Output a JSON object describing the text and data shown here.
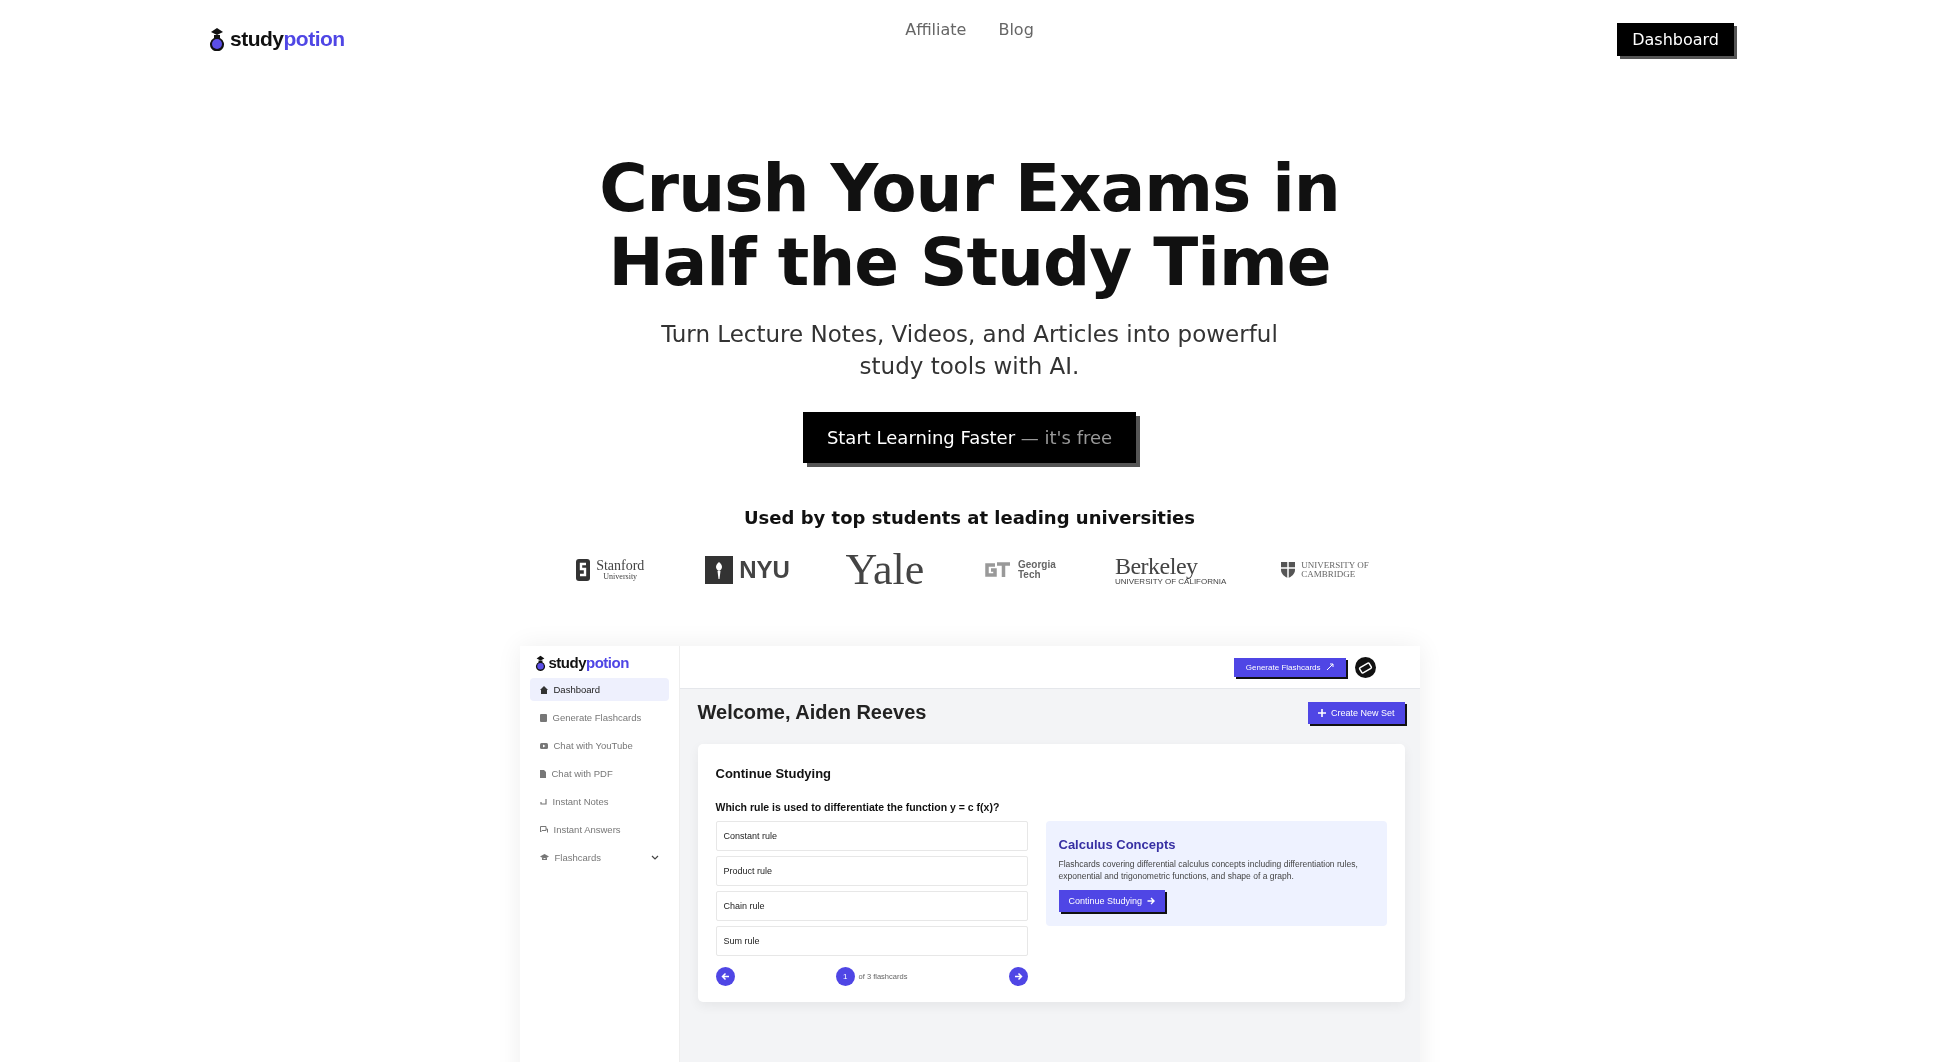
{
  "header": {
    "logo": {
      "first": "study",
      "second": "potion"
    },
    "nav": [
      "Affiliate",
      "Blog"
    ],
    "button": "Dashboard"
  },
  "hero": {
    "title_lines": [
      "Crush Your Exams in",
      "Half the Study Time"
    ],
    "subtitle": "Turn Lecture Notes, Videos, and Articles into powerful study tools with AI.",
    "cta": {
      "main": "Start Learning Faster",
      "aside": "— it's free"
    }
  },
  "universities": {
    "heading": "Used by top students at leading universities",
    "logos": [
      {
        "kind": "stanford",
        "name": "Stanford",
        "sub": "University"
      },
      {
        "kind": "nyu",
        "name": "NYU"
      },
      {
        "kind": "yale",
        "name": "Yale"
      },
      {
        "kind": "gatech",
        "name": "Georgia",
        "sub": "Tech"
      },
      {
        "kind": "berkeley",
        "name": "Berkeley",
        "sub": "UNIVERSITY OF CALIFORNIA"
      },
      {
        "kind": "cambridge",
        "name": "UNIVERSITY OF",
        "sub": "CAMBRIDGE"
      }
    ]
  },
  "app": {
    "logo": {
      "first": "study",
      "second": "potion"
    },
    "sidebar": [
      {
        "kind": "home",
        "label": "Dashboard",
        "selected": true
      },
      {
        "kind": "book",
        "label": "Generate Flashcards",
        "selected": false
      },
      {
        "kind": "video",
        "label": "Chat with YouTube",
        "selected": false
      },
      {
        "kind": "pdf",
        "label": "Chat with PDF",
        "selected": false
      },
      {
        "kind": "notes",
        "label": "Instant Notes",
        "selected": false
      },
      {
        "kind": "answers",
        "label": "Instant Answers",
        "selected": false
      },
      {
        "kind": "cap",
        "label": "Flashcards",
        "selected": false,
        "expanded": false
      }
    ],
    "top_button": "Generate Flashcards",
    "welcome": "Welcome, Aiden Reeves",
    "create_button": "Create New Set",
    "card": {
      "title": "Continue Studying",
      "question": "Which rule is used to differentiate the function y = c f(x)?",
      "options": [
        "Constant rule",
        "Product rule",
        "Chain rule",
        "Sum rule"
      ],
      "page": "1",
      "page_total": "of 3 flashcards",
      "set": {
        "title": "Calculus Concepts",
        "description": "Flashcards covering differential calculus concepts including differentiation rules, exponential and trigonometric functions, and shape of a graph.",
        "button": "Continue Studying"
      }
    }
  }
}
